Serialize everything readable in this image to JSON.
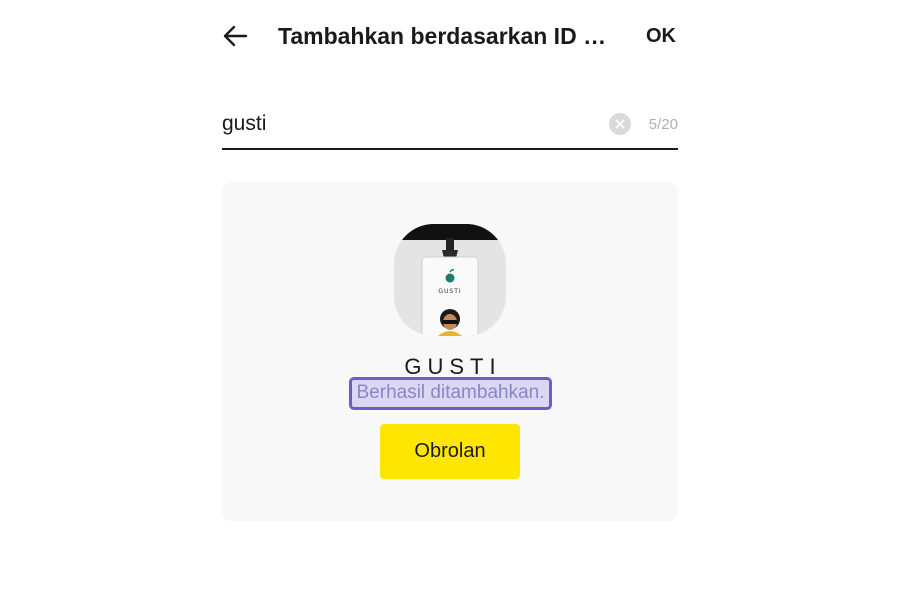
{
  "header": {
    "title": "Tambahkan berdasarkan ID Ka...",
    "ok_label": "OK",
    "back_icon": "arrow-left-icon"
  },
  "search": {
    "value": "gusti",
    "counter": "5/20",
    "clear_icon": "clear-circle-icon"
  },
  "result": {
    "badge_text": "GUSTI",
    "name": "GUSTI",
    "status": "Berhasil ditambahkan.",
    "chat_button_label": "Obrolan"
  },
  "colors": {
    "chat_button": "#ffe600",
    "status_highlight_border": "#6a5fc9",
    "card_background": "#f8f8f8"
  }
}
